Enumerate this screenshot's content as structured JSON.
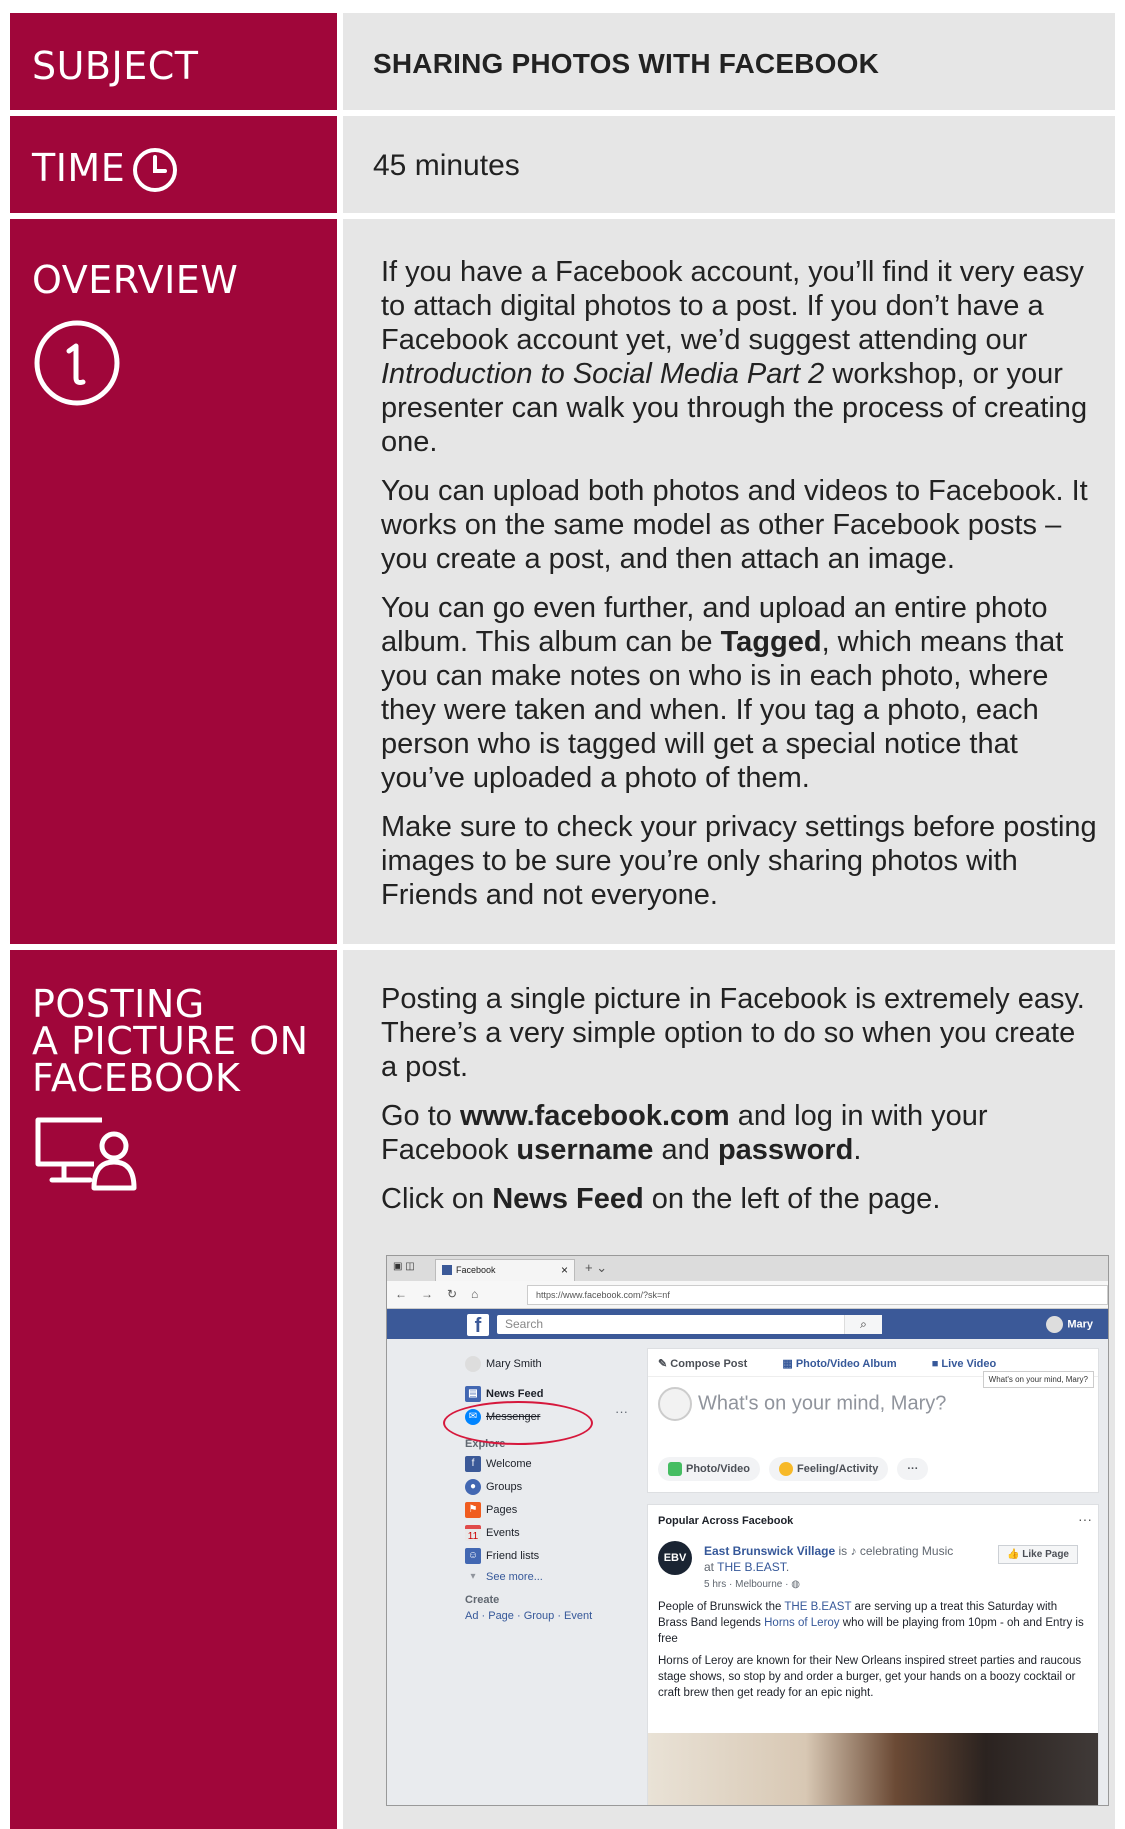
{
  "subject": {
    "label": "SUBJECT",
    "value": "SHARING PHOTOS WITH FACEBOOK"
  },
  "time": {
    "label": "TIME",
    "value": "45 minutes",
    "icon": "clock-icon"
  },
  "overview": {
    "label": "OVERVIEW",
    "icon": "info-icon",
    "p1_a": "If you have a Facebook account, you’ll find it very easy to attach digital photos to a post. If you don’t have a Facebook account yet, we’d suggest attending our ",
    "p1_em": "Introduction to Social Media Part 2",
    "p1_b": " workshop, or your presenter can walk you through the process of creating one.",
    "p2": "You can upload both photos and videos to Facebook. It works on the same model as other Facebook posts – you create a post, and then attach an image.",
    "p3_a": "You can go even further, and upload an entire photo album. This album can be ",
    "p3_strong": "Tagged",
    "p3_b": ", which means that you can make notes on who is in each photo, where they were taken and when. If you tag a photo, each person who is tagged will get a special notice that you’ve uploaded a photo of them.",
    "p4": "Make sure to check your privacy settings before posting images to be sure you’re only sharing photos with Friends and not everyone."
  },
  "posting": {
    "label_line1": "POSTING",
    "label_line2": "A PICTURE ON",
    "label_line3": "FACEBOOK",
    "icon": "computer-user-icon",
    "p1": "Posting a single picture in Facebook is extremely easy. There’s a very simple option to do so when you create a post.",
    "p2_a": "Go to ",
    "p2_url": "www.facebook.com",
    "p2_b": " and log in with your Facebook ",
    "p2_user": "username",
    "p2_c": " and ",
    "p2_pass": "password",
    "p2_d": ".",
    "p3_a": "Click on ",
    "p3_strong": "News Feed",
    "p3_b": " on the left of the page."
  },
  "screenshot": {
    "tab_title": "Facebook",
    "url": "https://www.facebook.com/?sk=nf",
    "search_placeholder": "Search",
    "user_name": "Mary",
    "nav": {
      "profile": "Mary Smith",
      "news_feed": "News Feed",
      "messenger": "Messenger",
      "explore_head": "Explore",
      "welcome": "Welcome",
      "groups": "Groups",
      "pages": "Pages",
      "events": "Events",
      "friend_lists": "Friend lists",
      "see_more": "See more...",
      "create_head": "Create",
      "create_links": "Ad · Page · Group · Event"
    },
    "composer": {
      "tab_compose": "Compose Post",
      "tab_album": "Photo/Video Album",
      "tab_live": "Live Video",
      "tooltip": "What's on your mind, Mary?",
      "prompt": "What's on your mind, Mary?",
      "btn_photo": "Photo/Video",
      "btn_feeling": "Feeling/Activity",
      "btn_more": "···"
    },
    "feed": {
      "heading": "Popular Across Facebook",
      "avatar_text": "EBV",
      "page_name": "East Brunswick Village",
      "is": " is ",
      "celebrating": "celebrating",
      "music_at": "Music at ",
      "venue": "THE B.EAST",
      "meta": "5 hrs · Melbourne ·",
      "like_button": "Like Page",
      "body1_a": "People of Brunswick the ",
      "body1_link1": "THE B.EAST",
      "body1_b": " are serving up a treat this Saturday with Brass Band legends ",
      "body1_link2": "Horns of Leroy",
      "body1_c": " who will be playing from 10pm - oh and Entry is free",
      "body2": "Horns of Leroy are known for their New Orleans inspired street parties and raucous stage shows, so stop by and order a burger, get your hands on a boozy cocktail or craft brew then get ready for an epic night."
    }
  }
}
